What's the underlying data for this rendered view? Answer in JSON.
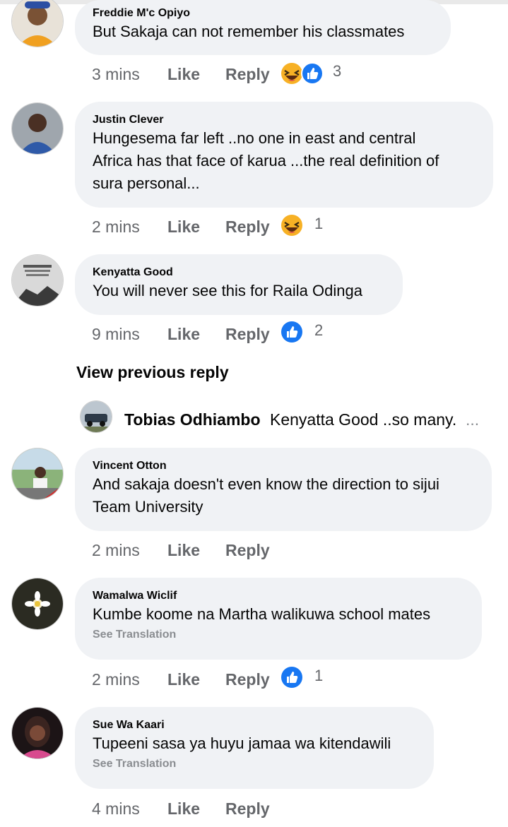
{
  "comments": [
    {
      "author": "Freddie M'c Opiyo",
      "text": "But Sakaja can not remember his classmates",
      "time": "3 mins",
      "like": "Like",
      "reply": "Reply",
      "reactions": [
        "haha",
        "like"
      ],
      "reaction_count": "3",
      "see_translation": ""
    },
    {
      "author": "Justin Clever",
      "text_lines": [
        "Hungesema far left ..no one in east and central",
        "Africa has that face of karua ...the real definition of",
        "sura personal..."
      ],
      "time": "2 mins",
      "like": "Like",
      "reply": "Reply",
      "reactions": [
        "haha"
      ],
      "reaction_count": "1"
    },
    {
      "author": "Kenyatta Good",
      "text": "You will never see this for Raila Odinga",
      "time": "9 mins",
      "like": "Like",
      "reply": "Reply",
      "reactions": [
        "like"
      ],
      "reaction_count": "2"
    },
    {
      "author": "Vincent Otton",
      "text_lines": [
        "And sakaja doesn't even know the direction to sijui",
        "Team University"
      ],
      "time": "2 mins",
      "like": "Like",
      "reply": "Reply"
    },
    {
      "author": "Wamalwa Wiclif",
      "text": "Kumbe koome na Martha walikuwa school mates",
      "see_translation": "See Translation",
      "time": "2 mins",
      "like": "Like",
      "reply": "Reply",
      "reactions": [
        "like"
      ],
      "reaction_count": "1"
    },
    {
      "author": "Sue Wa Kaari",
      "text": "Tupeeni sasa ya huyu jamaa wa kitendawili",
      "see_translation": "See Translation",
      "time": "4 mins",
      "like": "Like",
      "reply": "Reply"
    }
  ],
  "view_previous_reply": "View previous reply",
  "reply_preview": {
    "author": "Tobias Odhiambo",
    "text": "Kenyatta Good ..so many.",
    "ellipsis": "..."
  },
  "colors": {
    "bubble": "#f0f2f5",
    "meta": "#65676b",
    "like_blue": "#1877f2",
    "haha_yellow": "#f7b125"
  }
}
